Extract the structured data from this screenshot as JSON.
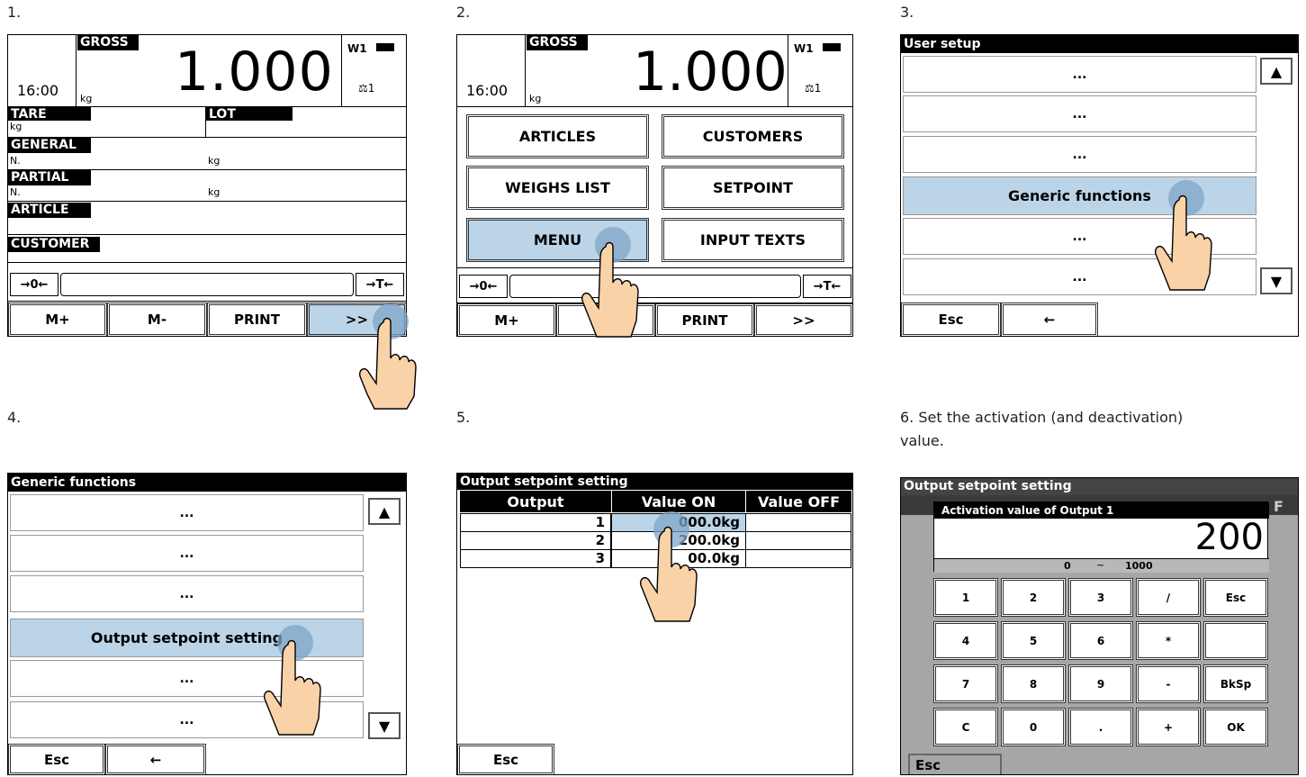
{
  "steps": {
    "s1": "1.",
    "s2": "2.",
    "s3": "3.",
    "s4": "4.",
    "s5": "5.",
    "s6": "6.  Set the activation (and deactivation)",
    "s6b": "value."
  },
  "weigh": {
    "gross": "GROSS",
    "time": "16:00",
    "unit": "kg",
    "value": "1.000",
    "w1": "W1",
    "scale": "1",
    "tare": "TARE",
    "tare_unit": "kg",
    "lot": "LOT",
    "general": "GENERAL",
    "general_n": "N.",
    "general_unit": "kg",
    "partial": "PARTIAL",
    "partial_n": "N.",
    "partial_unit": "kg",
    "article": "ARTICLE",
    "customer": "CUSTOMER",
    "zero": "→0←",
    "tare_btn": "→T←",
    "mplus": "M+",
    "mminus": "M-",
    "print": "PRINT",
    "more": ">>"
  },
  "menu": {
    "articles": "ARTICLES",
    "customers": "CUSTOMERS",
    "weighs_list": "WEIGHS LIST",
    "setpoint": "SETPOINT",
    "menu": "MENU",
    "input_texts": "INPUT TEXTS"
  },
  "user_setup": {
    "title": "User setup",
    "dots": "...",
    "generic": "Generic functions",
    "esc": "Esc",
    "back": "🡐"
  },
  "generic": {
    "title": "Generic functions",
    "dots": "...",
    "output_setpoint": "Output setpoint setting",
    "esc": "Esc",
    "back": "🡐"
  },
  "output_table": {
    "title": "Output setpoint setting",
    "headers": [
      "Output",
      "Value ON",
      "Value OFF"
    ],
    "rows": [
      {
        "output": "1",
        "on": "000.0kg",
        "off": ""
      },
      {
        "output": "2",
        "on": "200.0kg",
        "off": ""
      },
      {
        "output": "3",
        "on": "00.0kg",
        "off": ""
      }
    ],
    "esc": "Esc"
  },
  "keypad": {
    "title": "Output setpoint setting",
    "dialog_title": "Activation value of Output 1",
    "value": "200",
    "min": "0",
    "sep": "~",
    "max": "1000",
    "behind_letter": "F",
    "keys": [
      [
        "1",
        "2",
        "3",
        "/",
        "Esc"
      ],
      [
        "4",
        "5",
        "6",
        "*",
        ""
      ],
      [
        "7",
        "8",
        "9",
        "-",
        "BkSp"
      ],
      [
        "C",
        "0",
        ".",
        "+",
        "OK"
      ]
    ],
    "esc": "Esc"
  },
  "colors": {
    "highlight": "#bcd4e7",
    "touch": "#7fa6c8",
    "hand_fill": "#f9d2a8",
    "keypad_bg": "#a6a6a6"
  }
}
